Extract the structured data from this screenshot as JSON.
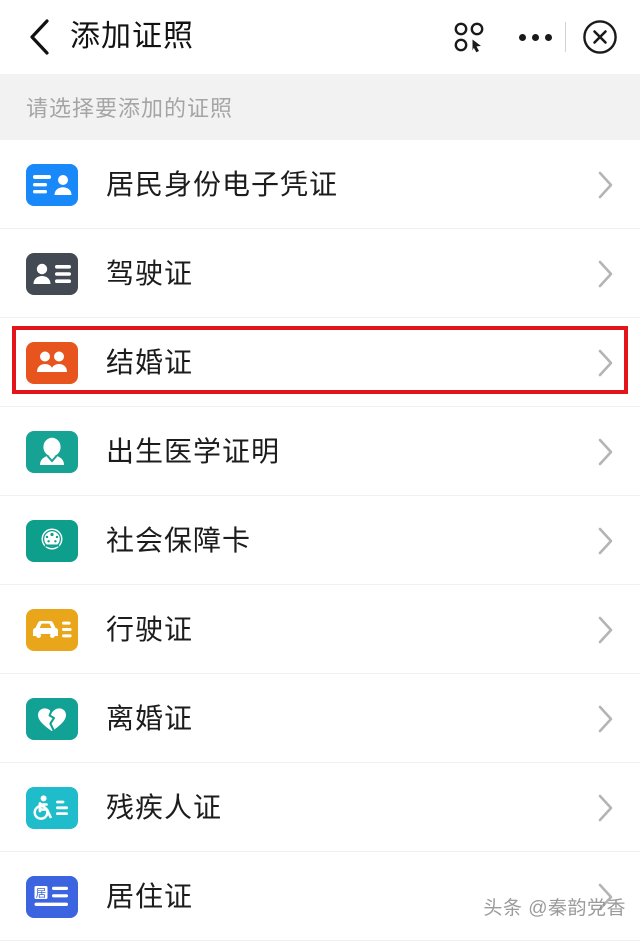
{
  "header": {
    "title": "添加证照",
    "back_icon": "chevron-left-icon",
    "mini_program_icon": "mini-program-icon",
    "more_icon": "more-options-icon",
    "close_icon": "close-circle-icon"
  },
  "section": {
    "label": "请选择要添加的证照"
  },
  "list": {
    "chevron_icon": "chevron-right-icon",
    "items": [
      {
        "label": "居民身份电子凭证",
        "icon": "id-card-icon",
        "color": "#1989fa"
      },
      {
        "label": "驾驶证",
        "icon": "driver-license-icon",
        "color": "#434a54"
      },
      {
        "label": "结婚证",
        "icon": "marriage-certificate-icon",
        "color": "#e8541e"
      },
      {
        "label": "出生医学证明",
        "icon": "birth-certificate-icon",
        "color": "#17a393"
      },
      {
        "label": "社会保障卡",
        "icon": "social-security-card-icon",
        "color": "#0d9e8c"
      },
      {
        "label": "行驶证",
        "icon": "vehicle-license-icon",
        "color": "#e9a61a"
      },
      {
        "label": "离婚证",
        "icon": "divorce-certificate-icon",
        "color": "#12a195"
      },
      {
        "label": "残疾人证",
        "icon": "disability-certificate-icon",
        "color": "#1fbccb"
      },
      {
        "label": "居住证",
        "icon": "residence-permit-icon",
        "color": "#3c63e0"
      }
    ]
  },
  "annotation": {
    "highlight_target": "结婚证",
    "color": "#e4141b"
  },
  "watermark": {
    "text": "头条 @秦韵党香"
  }
}
